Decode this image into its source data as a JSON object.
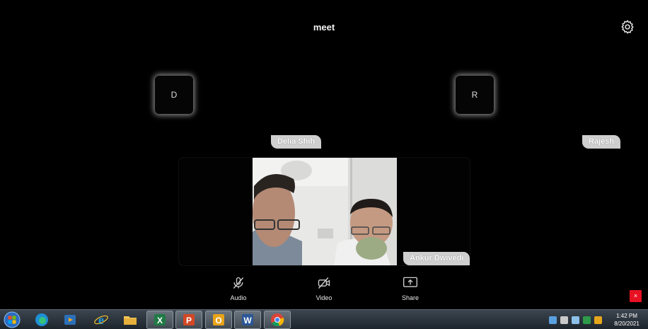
{
  "app": {
    "title": "meet",
    "settings_icon": "gear-icon"
  },
  "participants": [
    {
      "initial": "D",
      "name": "Delia Shih"
    },
    {
      "initial": "R",
      "name": "Rajesh"
    }
  ],
  "active_video": {
    "name": "Ankur Dwivedi"
  },
  "controls": {
    "audio_label": "Audio",
    "video_label": "Video",
    "share_label": "Share"
  },
  "close_label": "×",
  "taskbar": {
    "apps": [
      "windows-explorer",
      "edge",
      "media-player",
      "internet-explorer",
      "file-explorer",
      "excel",
      "powerpoint",
      "outlook",
      "word",
      "chrome"
    ],
    "clock_time": "1:42 PM",
    "clock_date": "8/20/2021"
  },
  "colors": {
    "background": "#000000",
    "name_tag": "#cfcfcf",
    "close": "#e81123"
  }
}
